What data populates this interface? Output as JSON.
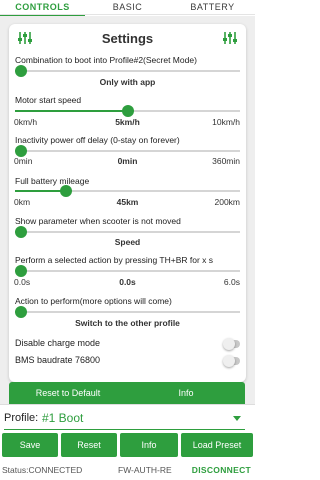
{
  "tabs": [
    {
      "label": "CONTROLS"
    },
    {
      "label": "BASIC"
    },
    {
      "label": "BATTERY"
    }
  ],
  "settings": {
    "title": "Settings",
    "icon_left": "sliders-icon",
    "icon_right": "sliders-icon"
  },
  "items": {
    "combination": {
      "label": "Combination to boot into Profile#2(Secret Mode)",
      "value_text": "Only with app",
      "level": 0
    },
    "motor_start": {
      "label": "Motor start speed",
      "min": "0km/h",
      "value": "5km/h",
      "max": "10km/h",
      "level": 0.5
    },
    "inactivity": {
      "label": "Inactivity power off delay (0-stay on forever)",
      "min": "0min",
      "value": "0min",
      "max": "360min",
      "level": 0
    },
    "full_battery": {
      "label": "Full battery mileage",
      "min": "0km",
      "value": "45km",
      "max": "200km",
      "level": 0.225
    },
    "show_param": {
      "label": "Show parameter when scooter is not moved",
      "value_text": "Speed",
      "level": 0
    },
    "perform_action": {
      "label": "Perform a selected action by pressing TH+BR for x s",
      "min": "0.0s",
      "value": "0.0s",
      "max": "6.0s",
      "level": 0
    },
    "action_to_perform": {
      "label": "Action to perform(more options will come)",
      "value_text": "Switch to the other profile",
      "level": 0
    },
    "disable_charge": {
      "label": "Disable charge mode",
      "on": false
    },
    "bms_baud": {
      "label": "BMS baudrate 76800",
      "on": false
    }
  },
  "card_buttons": {
    "reset_default": "Reset to Default",
    "info": "Info"
  },
  "profile": {
    "label": "Profile:",
    "value": "#1 Boot"
  },
  "actions": {
    "save": "Save",
    "reset": "Reset",
    "info": "Info",
    "load_preset": "Load Preset"
  },
  "status": {
    "status_text": "Status:CONNECTED",
    "fw_text": "FW-AUTH-RE",
    "disconnect": "DISCONNECT"
  },
  "colors": {
    "accent": "#2e9e3e"
  }
}
